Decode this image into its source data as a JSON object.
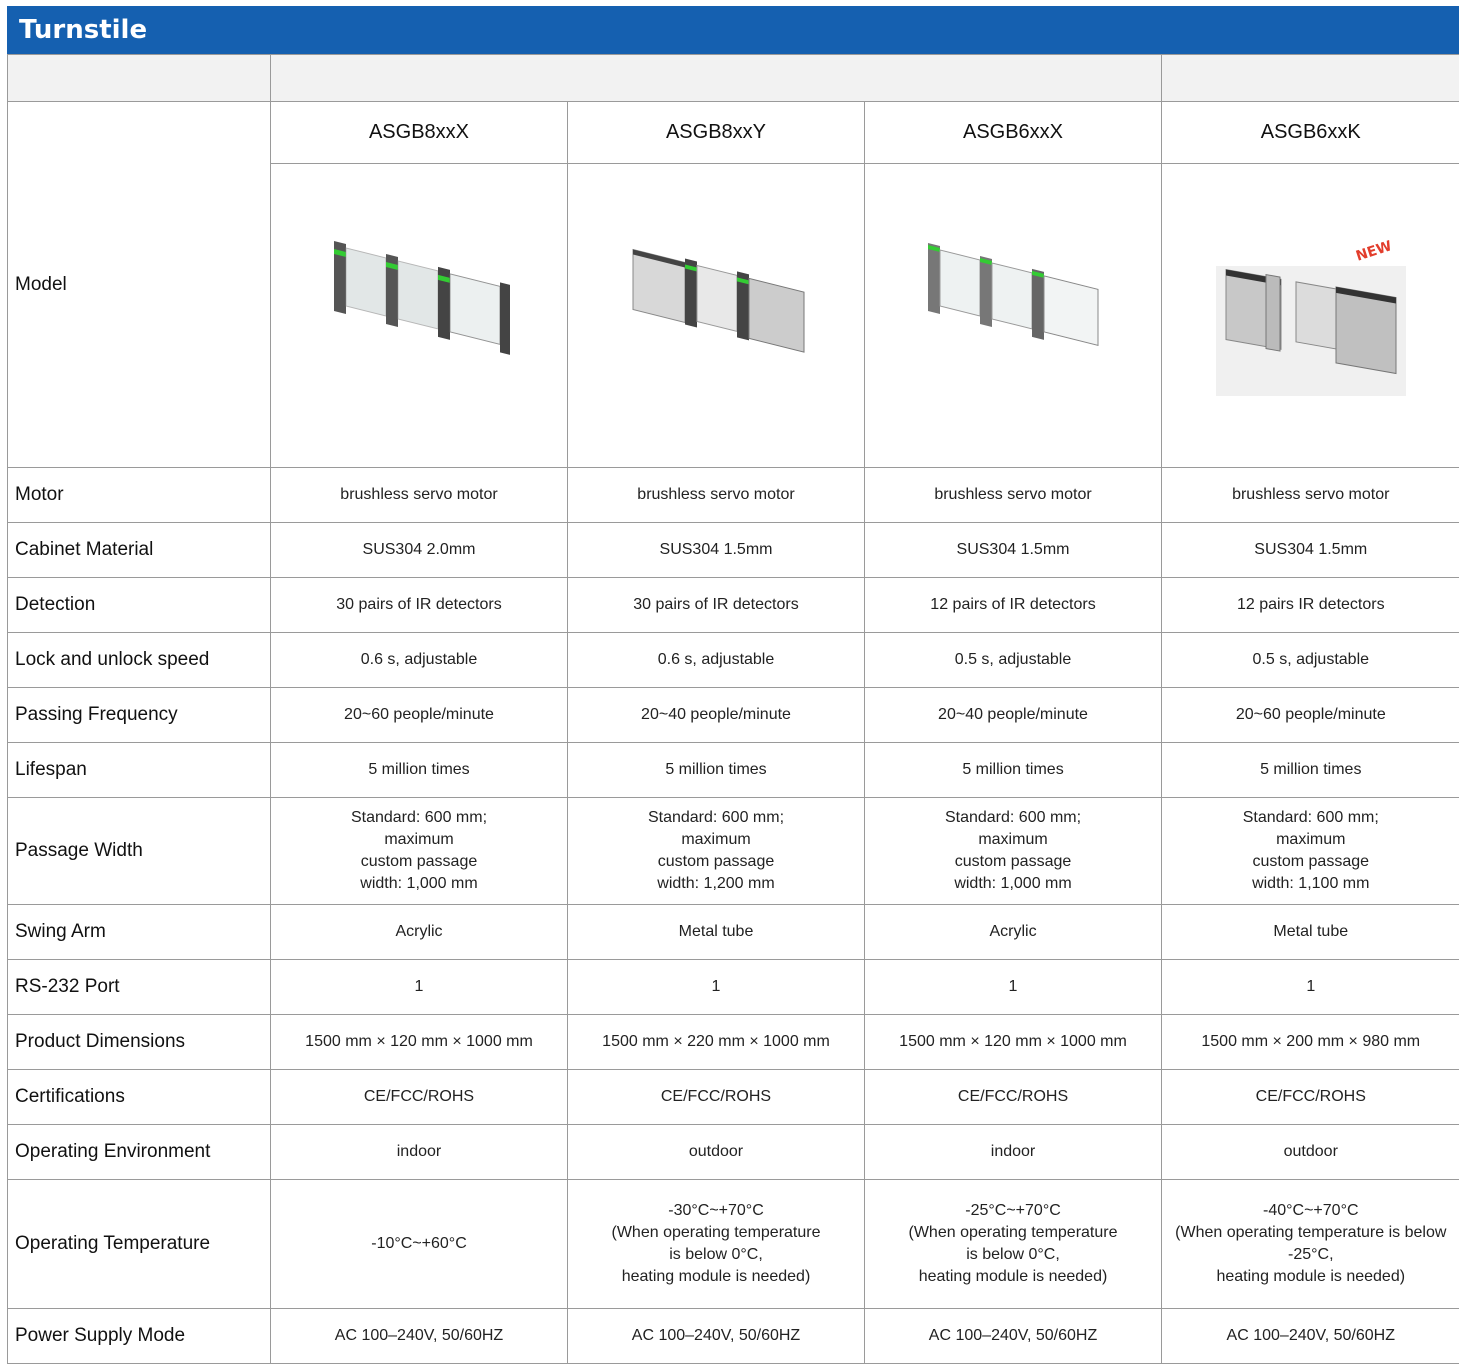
{
  "header": {
    "title": "Turnstile"
  },
  "model_label": "Model",
  "models": [
    {
      "name": "ASGB8xxX",
      "image": "swing-turnstile-acrylic-icon",
      "badge": ""
    },
    {
      "name": "ASGB8xxY",
      "image": "swing-turnstile-metal-tube-icon",
      "badge": ""
    },
    {
      "name": "ASGB6xxX",
      "image": "swing-turnstile-acrylic-icon",
      "badge": ""
    },
    {
      "name": "ASGB6xxK",
      "image": "swing-turnstile-metal-tube-icon",
      "badge": "NEW"
    }
  ],
  "rows": [
    {
      "label": "Motor",
      "values": [
        "brushless servo motor",
        "brushless servo motor",
        "brushless servo motor",
        "brushless servo motor"
      ]
    },
    {
      "label": "Cabinet Material",
      "values": [
        "SUS304 2.0mm",
        "SUS304 1.5mm",
        "SUS304 1.5mm",
        "SUS304 1.5mm"
      ]
    },
    {
      "label": "Detection",
      "values": [
        "30 pairs of IR detectors",
        "30 pairs of IR detectors",
        "12 pairs of IR detectors",
        "12 pairs IR detectors"
      ]
    },
    {
      "label": "Lock and unlock speed",
      "values": [
        "0.6 s, adjustable",
        "0.6 s, adjustable",
        "0.5 s, adjustable",
        "0.5 s, adjustable"
      ]
    },
    {
      "label": "Passing Frequency",
      "values": [
        "20~60 people/minute",
        "20~40 people/minute",
        "20~40 people/minute",
        "20~60 people/minute"
      ]
    },
    {
      "label": "Lifespan",
      "values": [
        "5 million times",
        "5 million times",
        "5 million times",
        "5 million times"
      ]
    },
    {
      "label": "Passage Width",
      "values": [
        "Standard: 600 mm;\nmaximum\ncustom passage\nwidth: 1,000 mm",
        "Standard: 600 mm;\nmaximum\ncustom passage\nwidth: 1,200 mm",
        "Standard: 600 mm;\nmaximum\ncustom passage\nwidth: 1,000 mm",
        "Standard: 600 mm;\nmaximum\ncustom passage\nwidth: 1,100 mm"
      ]
    },
    {
      "label": "Swing Arm",
      "values": [
        "Acrylic",
        "Metal tube",
        "Acrylic",
        "Metal tube"
      ]
    },
    {
      "label": "RS-232 Port",
      "values": [
        "1",
        "1",
        "1",
        "1"
      ]
    },
    {
      "label": "Product Dimensions",
      "values": [
        "1500 mm × 120 mm × 1000 mm",
        "1500 mm × 220 mm × 1000 mm",
        "1500 mm × 120 mm × 1000 mm",
        "1500 mm × 200 mm × 980 mm"
      ]
    },
    {
      "label": "Certifications",
      "values": [
        "CE/FCC/ROHS",
        "CE/FCC/ROHS",
        "CE/FCC/ROHS",
        "CE/FCC/ROHS"
      ]
    },
    {
      "label": "Operating Environment",
      "values": [
        "indoor",
        "outdoor",
        "indoor",
        "outdoor"
      ]
    },
    {
      "label": "Operating Temperature",
      "values": [
        "-10°C~+60°C",
        "-30°C~+70°C\n(When operating temperature\nis below 0°C,\nheating module is needed)",
        "-25°C~+70°C\n(When operating temperature\nis below 0°C,\nheating module is needed)",
        "-40°C~+70°C\n(When operating temperature is below\n-25°C,\nheating module is needed)"
      ]
    },
    {
      "label": "Power Supply Mode",
      "values": [
        "AC 100–240V, 50/60HZ",
        "AC 100–240V, 50/60HZ",
        "AC 100–240V, 50/60HZ",
        "AC 100–240V, 50/60HZ"
      ]
    }
  ]
}
